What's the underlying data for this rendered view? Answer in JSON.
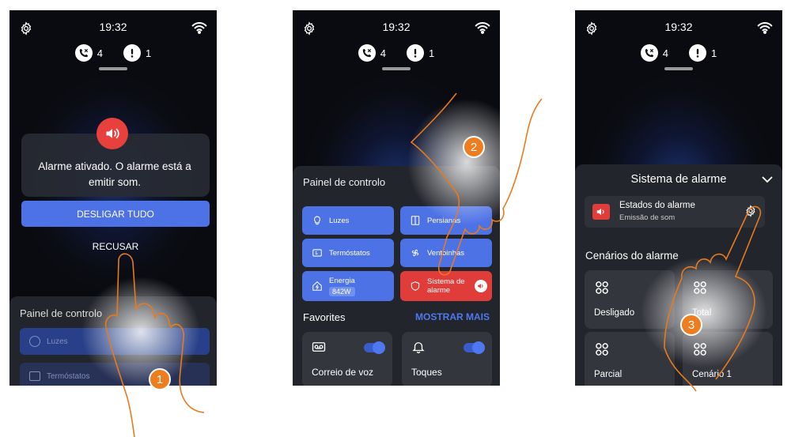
{
  "status_bar": {
    "time": "19:32",
    "missed_calls": "4",
    "alerts": "1",
    "icons": [
      "settings-gear-icon",
      "missed-call-icon",
      "alert-icon",
      "wifi-icon"
    ]
  },
  "screen1": {
    "alarm_message": "Alarme ativado. O alarme está a emitir som.",
    "turn_off_all_label": "DESLIGAR TUDO",
    "refuse_label": "RECUSAR",
    "panel_title": "Painel de controlo",
    "panel_items": [
      "Luzes",
      "Termóstatos"
    ],
    "step": "1"
  },
  "screen2": {
    "panel_title": "Painel de controlo",
    "tiles": {
      "lights": "Luzes",
      "blinds": "Persianas",
      "thermostats": "Termóstatos",
      "fans": "Ventoinhas",
      "energy": "Energia",
      "energy_value": "842W",
      "alarm_system": "Sistema de alarme"
    },
    "favorites_title": "Favorites",
    "show_more_label": "MOSTRAR MAIS",
    "favorites": {
      "voicemail": "Correio de voz",
      "ringtones": "Toques"
    },
    "step": "2"
  },
  "screen3": {
    "title": "Sistema de alarme",
    "state_title": "Estados do alarme",
    "state_subtitle": "Emissão de som",
    "scenarios_title": "Cenários do alarme",
    "scenarios": [
      "Desligado",
      "Total",
      "Parcial",
      "Cenário 1"
    ],
    "step": "3"
  },
  "colors": {
    "accent_blue": "#4d72e6",
    "alarm_red": "#e03d3a",
    "step_orange": "#ee7d1f",
    "link_blue": "#4d78f0"
  }
}
